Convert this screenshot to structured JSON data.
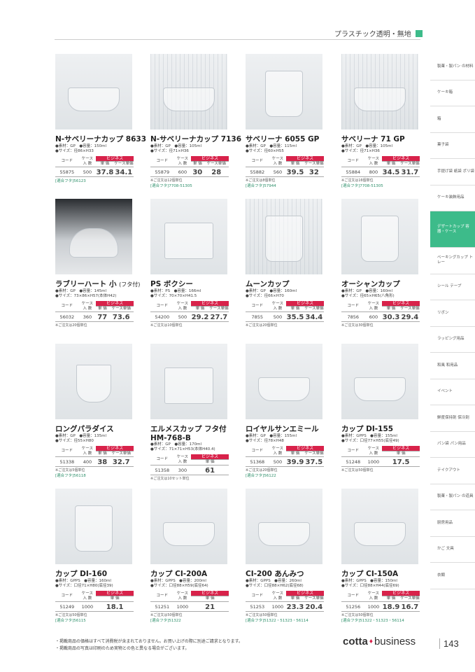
{
  "header": {
    "title": "プラスチック透明・無地"
  },
  "labels": {
    "code": "コード",
    "case_line1": "ケース",
    "case_line2": "入 数",
    "business": "ビジネス",
    "unit": "単 価",
    "case_unit": "ケース単価"
  },
  "products": [
    {
      "name": "N-サベリーナカップ 8633",
      "spec1": "●素材：GP　●容量：150ml",
      "spec2": "●サイズ：径86×H33",
      "code": "55875",
      "case": "500",
      "price1": "37.8",
      "price2": "34.1",
      "note": "",
      "fit": "[適合フタ]56123"
    },
    {
      "name": "N-サベリーナカップ 7136",
      "spec1": "●素材：GP　●容量：105ml",
      "spec2": "●サイズ：径71×H36",
      "code": "55879",
      "case": "600",
      "price1": "30",
      "price2": "28",
      "note": "※ご注文は12個単位",
      "fit": "[適合フタ]7708-51305"
    },
    {
      "name": "サベリーナ 6055 GP",
      "spec1": "●素材：GP　●容量：115ml",
      "spec2": "●サイズ：径60×H55",
      "code": "55882",
      "case": "560",
      "price1": "39.5",
      "price2": "32",
      "note": "※ご注文は8個単位",
      "fit": "[適合フタ]57944"
    },
    {
      "name": "サベリーナ 71 GP",
      "spec1": "●素材：GP　●容量：105ml",
      "spec2": "●サイズ：径71×H36",
      "code": "55884",
      "case": "800",
      "price1": "34.5",
      "price2": "31.7",
      "note": "※ご注文は16個単位",
      "fit": "[適合フタ]7708-51305"
    },
    {
      "name": "ラブリーハート 小",
      "sub": "(フタ付)",
      "spec1": "●素材：GP　●容量：145ml",
      "spec2": "●サイズ：73×86×H57(本体H42)",
      "code": "56032",
      "case": "360",
      "price1": "77",
      "price2": "73.6",
      "note": "※ご注文は20個単位",
      "fit": ""
    },
    {
      "name": "PS ボクシー",
      "spec1": "●素材：PS　●容量：166ml",
      "spec2": "●サイズ：70×70×H41.5",
      "code": "54200",
      "case": "500",
      "price1": "29.2",
      "price2": "27.7",
      "note": "※ご注文は10個単位",
      "fit": ""
    },
    {
      "name": "ムーンカップ",
      "spec1": "●素材：GP　●容量：160ml",
      "spec2": "●サイズ：径66×H70",
      "code": "7855",
      "case": "500",
      "price1": "35.5",
      "price2": "34.4",
      "note": "※ご注文は20個単位",
      "fit": ""
    },
    {
      "name": "オーシャンカップ",
      "spec1": "●素材：GP　●容量：160ml",
      "spec2": "●サイズ：径65×H65(八角形)",
      "code": "7856",
      "case": "600",
      "price1": "30.3",
      "price2": "29.4",
      "note": "※ご注文は30個単位",
      "fit": ""
    },
    {
      "name": "ロングパラダイス",
      "spec1": "●素材：GP　●容量：135ml",
      "spec2": "●サイズ：径55×H80",
      "code": "51338",
      "case": "400",
      "price1": "38",
      "price2": "32.7",
      "note": "※ご注文は5個単位",
      "fit": "[適合フタ]56118"
    },
    {
      "name": "エルメスカップ フタ付",
      "name2": "HM-768-B",
      "spec1": "●素材：GP　●容量：170ml",
      "spec2": "●サイズ：71×71×H53(本体H40.4)",
      "code": "51358",
      "case": "300",
      "price1": "61",
      "price2": "",
      "note": "※ご注文は10セット単位",
      "fit": ""
    },
    {
      "name": "ロイヤルサンエミール",
      "spec1": "●素材：GP　●容量：155ml",
      "spec2": "●サイズ：径78×H48",
      "code": "51368",
      "case": "500",
      "price1": "39.9",
      "price2": "37.5",
      "note": "※ご注文は20個単位",
      "fit": "[適合フタ]56122"
    },
    {
      "name": "カップ DI-155",
      "spec1": "●素材：GPPS　●容量：155ml",
      "spec2": "●サイズ：口径77×H55(底径49)",
      "code": "51248",
      "case": "1000",
      "price1": "17.5",
      "price2": "",
      "note": "※ご注文は50個単位",
      "fit": ""
    },
    {
      "name": "カップ DI-160",
      "spec1": "●素材：GPPS　●容量：160ml",
      "spec2": "●サイズ：口径71×H80(底径39)",
      "code": "51249",
      "case": "1000",
      "price1": "18.1",
      "price2": "",
      "note": "※ご注文は50個単位",
      "fit": "[適合フタ]56115"
    },
    {
      "name": "カップ CI-200A",
      "spec1": "●素材：GPPS　●容量：200ml",
      "spec2": "●サイズ：口径88×H59(底径64)",
      "code": "51251",
      "case": "1000",
      "price1": "21",
      "price2": "",
      "note": "※ご注文は50個単位",
      "fit": "[適合フタ]51322"
    },
    {
      "name": "CI-200 あんみつ",
      "spec1": "●素材：GPPS　●容量：260ml",
      "spec2": "●サイズ：口径88×H62(底径68)",
      "code": "51253",
      "case": "1000",
      "price1": "23.3",
      "price2": "20.4",
      "note": "※ご注文は50個単位",
      "fit": "[適合フタ]51322・51323・56114"
    },
    {
      "name": "カップ CI-150A",
      "spec1": "●素材：GPPS　●容量：150ml",
      "spec2": "●サイズ：口径88×H44(底径69)",
      "code": "51256",
      "case": "1000",
      "price1": "18.9",
      "price2": "16.7",
      "note": "※ご注文は50個単位",
      "fit": "[適合フタ]51322・51323・56114"
    }
  ],
  "sidebar": [
    "製菓・製パン の材料",
    "ケーキ箱",
    "箱",
    "菓子袋",
    "手提げ袋 紙袋 ポリ袋",
    "ケーキ装飾用品",
    "デザートカップ 容器・ケース",
    "ベーキングカップ トレー",
    "シール テープ",
    "リボン",
    "ラッピング用品",
    "和風 和用品",
    "イベント",
    "鮮度保持剤 保冷剤",
    "パン袋 パン用品",
    "テイクアウト",
    "製菓・製パン の道具",
    "厨房用品",
    "かご 文具",
    "衣類"
  ],
  "footer": {
    "note1": "・掲載商品の価格はすべて消費税が含まれておりません。お買い上げの際に別途ご請求となります。",
    "note2": "・掲載商品の写真は印刷のため実物との色と異なる場合がございます。",
    "brand1": "cotta",
    "brand2": "business",
    "page": "143"
  }
}
